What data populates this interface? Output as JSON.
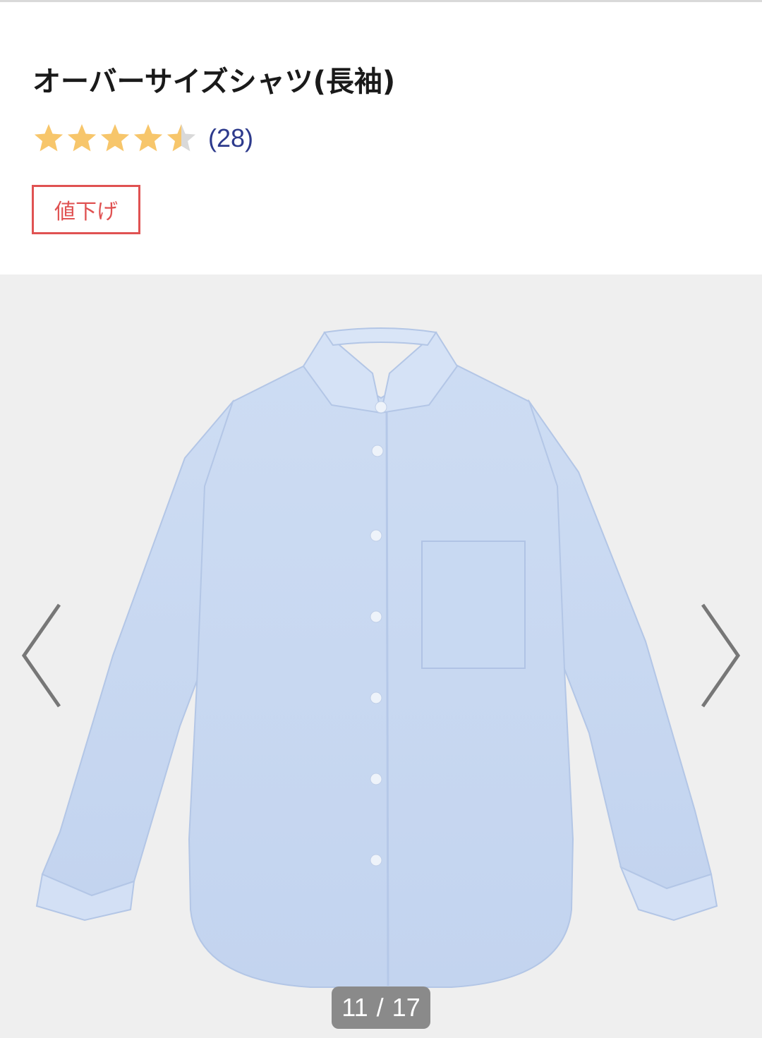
{
  "product": {
    "title": "オーバーサイズシャツ(長袖)",
    "rating": 4.5,
    "rating_max": 5,
    "review_count_label": "(28)",
    "badge_label": "値下げ"
  },
  "colors": {
    "star_fill": "#f7c66b",
    "star_empty": "#d9d9d9",
    "badge_red": "#e05252",
    "link_blue": "#2d3a8c",
    "gallery_bg": "#efefef",
    "shirt_blue": "#c7d8f1"
  },
  "gallery": {
    "current": "11",
    "separator": "/",
    "total": "17",
    "prev_icon": "chevron-left-icon",
    "next_icon": "chevron-right-icon"
  }
}
